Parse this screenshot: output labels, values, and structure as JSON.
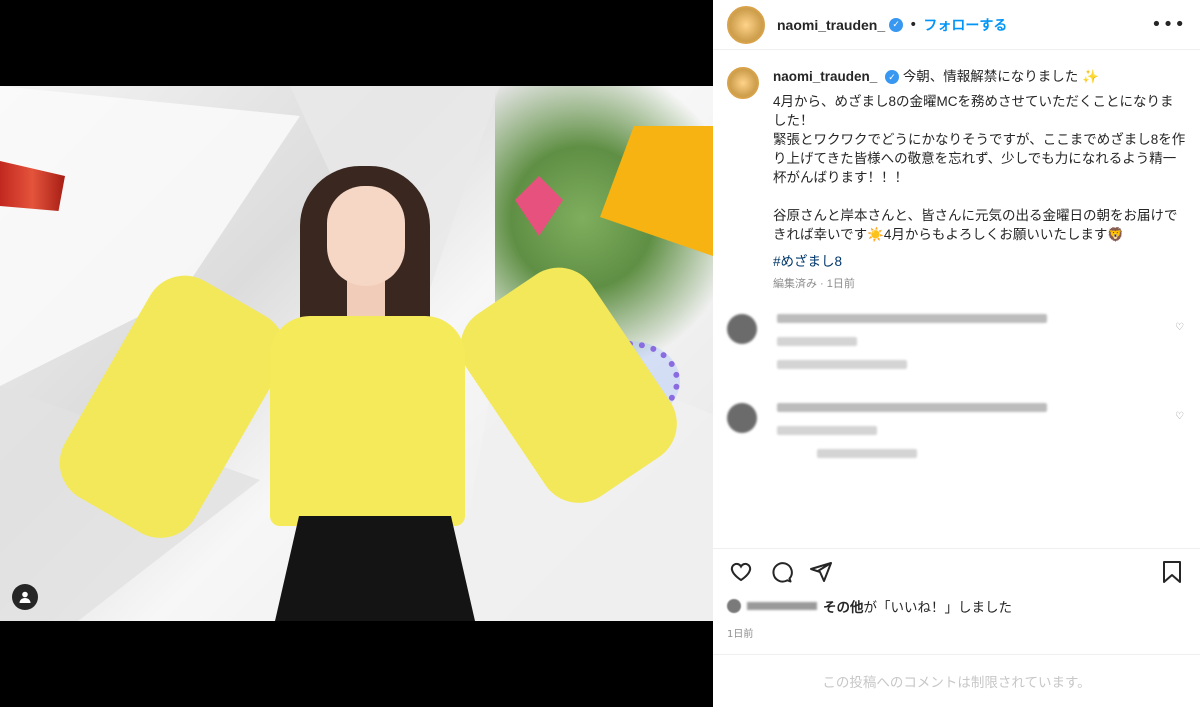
{
  "post": {
    "username": "naomi_trauden_",
    "verified_icon": "verified-badge-icon",
    "follow_label": "フォローする",
    "separator": "•",
    "more_icon": "more-options-icon",
    "caption_first": "今朝、情報解禁になりました",
    "caption_body": "4月から、めざまし8の金曜MCを務めさせていただくことになりました！\n緊張とワクワクでどうにかなりそうですが、ここまでめざまし8を作り上げてきた皆様への敬意を忘れず、少しでも力になれるよう精一杯がんばります！！！\n\n谷原さんと岸本さんと、皆さんに元気の出る金曜日の朝をお届けできれば幸いです☀️4月からもよろしくお願いいたします🦁",
    "hashtag": "#めざまし8",
    "meta": "編集済み · 1日前",
    "likes_others": "その他",
    "likes_suffix": "が「いいね！」しました",
    "likes_prefix": "が",
    "time_ago": "1日前",
    "comments_restricted": "この投稿へのコメントは制限されています。"
  },
  "colors": {
    "follow": "#0095f6",
    "verified": "#3897f0",
    "text": "#262626",
    "muted": "#8e8e8e"
  }
}
